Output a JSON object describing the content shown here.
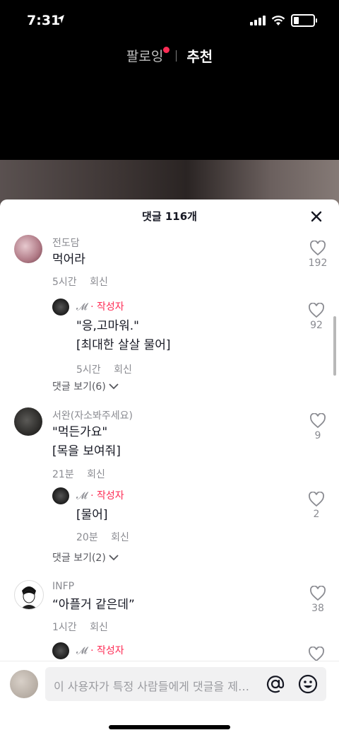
{
  "status_bar": {
    "time": "7:31"
  },
  "top_tabs": {
    "following": "팔로잉",
    "recommended": "추천"
  },
  "sheet": {
    "title": "댓글 116개"
  },
  "comments": [
    {
      "name": "전도담",
      "lines": [
        "먹어라"
      ],
      "time": "5시간",
      "reply": "회신",
      "likes": "192",
      "replies": [
        {
          "name": "𝓜",
          "badge": "· 작성자",
          "lines": [
            "\"응,고마워.\"",
            "[최대한 살살 물어]"
          ],
          "time": "5시간",
          "reply": "회신",
          "likes": "92"
        }
      ],
      "more": "댓글 보기(6)"
    },
    {
      "name": "서완(자소봐주세요)",
      "lines": [
        "\"먹든가요\"",
        "[목을 보여줘]"
      ],
      "time": "21분",
      "reply": "회신",
      "likes": "9",
      "replies": [
        {
          "name": "𝓜",
          "badge": "· 작성자",
          "lines": [
            "[물어]"
          ],
          "time": "20분",
          "reply": "회신",
          "likes": "2"
        }
      ],
      "more": "댓글 보기(2)"
    },
    {
      "name": "INFP",
      "lines": [
        "“아플거 같은데”"
      ],
      "time": "1시간",
      "reply": "회신",
      "likes": "38",
      "replies": [
        {
          "name": "𝓜",
          "badge": "· 작성자"
        }
      ]
    }
  ],
  "input": {
    "placeholder": "이 사용자가 특정 사람들에게 댓글을 제…"
  },
  "colors": {
    "accent": "#fe2c55",
    "muted": "#8a8b91"
  }
}
